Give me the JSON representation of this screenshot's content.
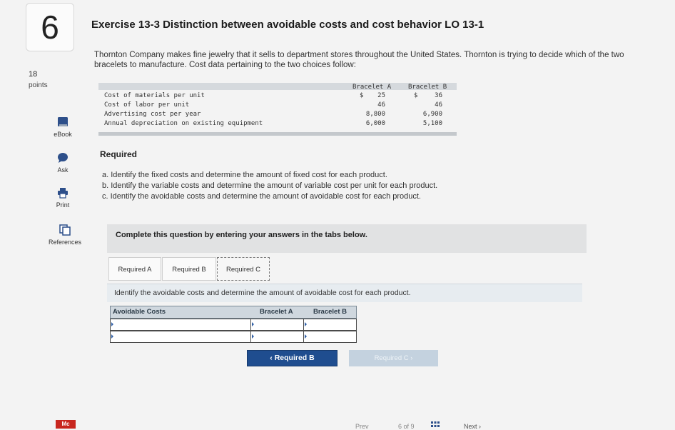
{
  "question": {
    "number": "6",
    "points_value": "18",
    "points_label": "points"
  },
  "toolbar": {
    "ebook": "eBook",
    "ask": "Ask",
    "print": "Print",
    "references": "References"
  },
  "title": "Exercise 13-3 Distinction between avoidable costs and cost behavior LO 13-1",
  "intro": "Thornton Company makes fine jewelry that it sells to department stores throughout the United States. Thornton is trying to decide which of the two bracelets to manufacture. Cost data pertaining to the two choices follow:",
  "cost_table": {
    "headers": [
      "Bracelet A",
      "Bracelet B"
    ],
    "rows": [
      {
        "label": "Cost of materials per unit",
        "a": "25",
        "b": "36",
        "currency": "$"
      },
      {
        "label": "Cost of labor per unit",
        "a": "46",
        "b": "46"
      },
      {
        "label": "Advertising cost per year",
        "a": "8,800",
        "b": "6,900"
      },
      {
        "label": "Annual depreciation on existing equipment",
        "a": "6,000",
        "b": "5,100"
      }
    ]
  },
  "required": {
    "heading": "Required",
    "a": "a. Identify the fixed costs and determine the amount of fixed cost for each product.",
    "b": "b. Identify the variable costs and determine the amount of variable cost per unit for each product.",
    "c": "c. Identify the avoidable costs and determine the amount of avoidable cost for each product."
  },
  "complete_text": "Complete this question by entering your answers in the tabs below.",
  "tabs": [
    "Required A",
    "Required B",
    "Required C"
  ],
  "instruction": "Identify the avoidable costs and determine the amount of avoidable cost for each product.",
  "answer_grid": {
    "headers": [
      "Avoidable Costs",
      "Bracelet A",
      "Bracelet B"
    ],
    "rows": [
      [
        "",
        "",
        ""
      ],
      [
        "",
        "",
        ""
      ]
    ]
  },
  "nav": {
    "prev": "Required B",
    "next": "Required C"
  },
  "footer": {
    "logo": "Mc",
    "prev": "Prev",
    "page": "6 of 9",
    "next": "Next"
  }
}
